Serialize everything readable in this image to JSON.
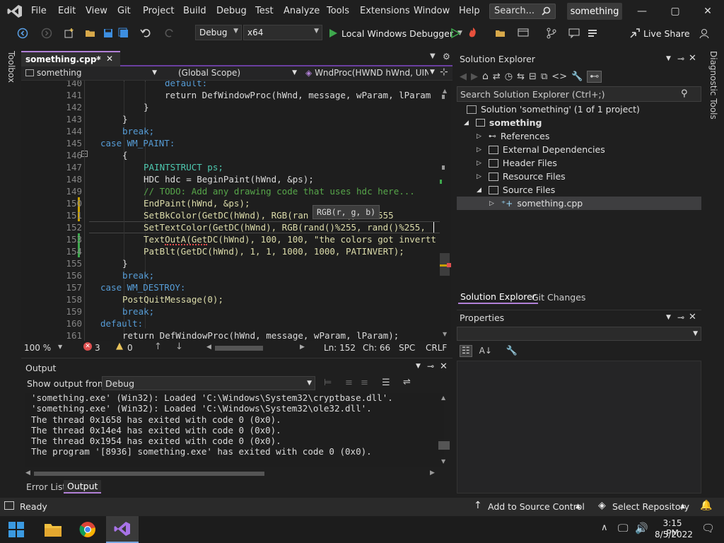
{
  "menubar": {
    "items": [
      "File",
      "Edit",
      "View",
      "Git",
      "Project",
      "Build",
      "Debug",
      "Test",
      "Analyze",
      "Tools",
      "Extensions",
      "Window",
      "Help"
    ],
    "search_label": "Search...",
    "solution_name": "something"
  },
  "toolbar": {
    "config": "Debug",
    "platform": "x64",
    "debugger": "Local Windows Debugger",
    "live_share": "Live Share"
  },
  "left_strip": {
    "toolbox": "Toolbox"
  },
  "right_strip": {
    "diagnostic": "Diagnostic Tools"
  },
  "editor": {
    "tab_label": "something.cpp*",
    "nav_project": "something",
    "nav_scope": "(Global Scope)",
    "nav_member": "WndProc(HWND hWnd, UINT",
    "tooltip": "RGB(r, g, b)",
    "lines": [
      {
        "n": "140",
        "text": "default:"
      },
      {
        "n": "141",
        "text": "return DefWindowProc(hWnd, message, wParam, lParam"
      },
      {
        "n": "142",
        "text": "}"
      },
      {
        "n": "143",
        "text": "}"
      },
      {
        "n": "144",
        "text": "break;"
      },
      {
        "n": "145",
        "text": "case WM_PAINT:"
      },
      {
        "n": "146",
        "text": "{"
      },
      {
        "n": "147",
        "text": "PAINTSTRUCT ps;"
      },
      {
        "n": "148",
        "text": "HDC hdc = BeginPaint(hWnd, &ps);"
      },
      {
        "n": "149",
        "text": "// TODO: Add any drawing code that uses hdc here..."
      },
      {
        "n": "150",
        "text": "EndPaint(hWnd, &ps);"
      },
      {
        "n": "151",
        "text": "SetBkColor(GetDC(hWnd), RGB(ran   rand() % 2555"
      },
      {
        "n": "152",
        "text": "SetTextColor(GetDC(hWnd), RGB(rand()%255, rand()%255,"
      },
      {
        "n": "153",
        "text": "TextOutA(GetDC(hWnd), 100, 100, \"the colors got invertt"
      },
      {
        "n": "154",
        "text": "PatBlt(GetDC(hWnd), 1, 1, 1000, 1000, PATINVERT);"
      },
      {
        "n": "155",
        "text": "}"
      },
      {
        "n": "156",
        "text": "break;"
      },
      {
        "n": "157",
        "text": "case WM_DESTROY:"
      },
      {
        "n": "158",
        "text": "PostQuitMessage(0);"
      },
      {
        "n": "159",
        "text": "break;"
      },
      {
        "n": "160",
        "text": "default:"
      },
      {
        "n": "161",
        "text": "return DefWindowProc(hWnd, message, wParam, lParam);"
      }
    ],
    "status": {
      "zoom": "100 %",
      "errors": "3",
      "warnings": "0",
      "line": "Ln: 152",
      "col": "Ch: 66",
      "whitespace": "SPC",
      "line_ending": "CRLF"
    }
  },
  "output": {
    "title": "Output",
    "show_from_label": "Show output from:",
    "source": "Debug",
    "lines": [
      "'something.exe' (Win32): Loaded 'C:\\Windows\\System32\\cryptbase.dll'.",
      "'something.exe' (Win32): Loaded 'C:\\Windows\\System32\\ole32.dll'.",
      "The thread 0x1658 has exited with code 0 (0x0).",
      "The thread 0x14e4 has exited with code 0 (0x0).",
      "The thread 0x1954 has exited with code 0 (0x0).",
      "The program '[8936] something.exe' has exited with code 0 (0x0)."
    ],
    "tabs": [
      "Error List",
      "Output"
    ]
  },
  "solution_explorer": {
    "title": "Solution Explorer",
    "search_placeholder": "Search Solution Explorer (Ctrl+;)",
    "solution": "Solution 'something' (1 of 1 project)",
    "project": "something",
    "nodes": [
      "References",
      "External Dependencies",
      "Header Files",
      "Resource Files",
      "Source Files"
    ],
    "file": "something.cpp",
    "tabs": [
      "Solution Explorer",
      "Git Changes"
    ]
  },
  "properties": {
    "title": "Properties"
  },
  "statusbar": {
    "ready": "Ready",
    "add_source": "Add to Source Control",
    "select_repo": "Select Repository"
  },
  "taskbar": {
    "time": "3:15 PM",
    "date": "8/5/2022"
  },
  "colors": {
    "accent": "#b180d7",
    "vs_purple": "#68217a",
    "debug_green": "#3ea84d"
  }
}
